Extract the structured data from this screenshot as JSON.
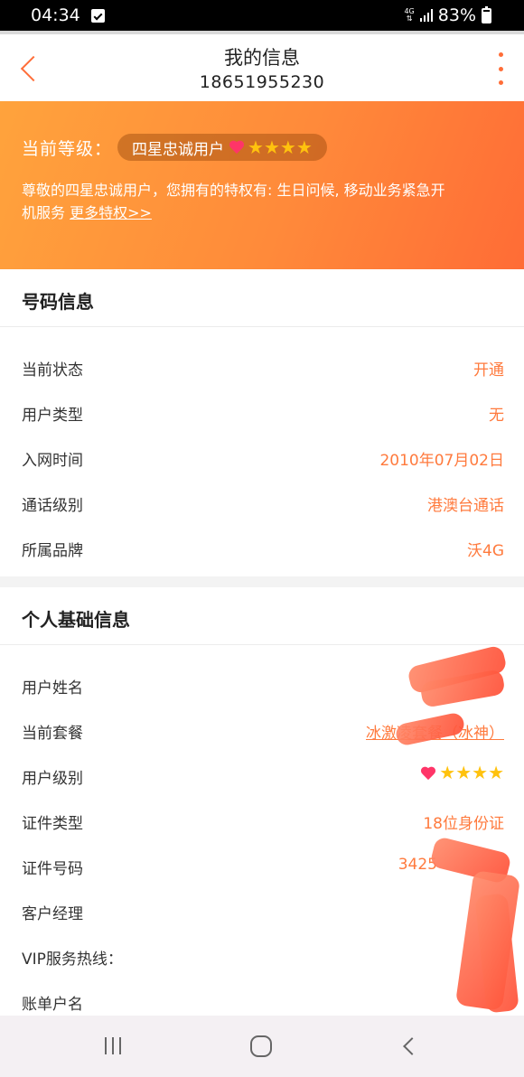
{
  "status_bar": {
    "time": "04:34",
    "network": "4G",
    "battery": "83%",
    "battery_level": 0.83
  },
  "header": {
    "title": "我的信息",
    "phone": "18651955230"
  },
  "banner": {
    "level_label": "当前等级：",
    "level_name": "四星忠诚用户",
    "stars": 4,
    "privilege_text": "尊敬的四星忠诚用户，您拥有的特权有: 生日问候, 移动业务紧急开机服务 ",
    "more_link": "更多特权>>"
  },
  "number_info": {
    "title": "号码信息",
    "rows": [
      {
        "label": "当前状态",
        "value": "开通"
      },
      {
        "label": "用户类型",
        "value": "无"
      },
      {
        "label": "入网时间",
        "value": "2010年07月02日"
      },
      {
        "label": "通话级别",
        "value": "港澳台通话"
      },
      {
        "label": "所属品牌",
        "value": "沃4G"
      }
    ]
  },
  "personal_info": {
    "title": "个人基础信息",
    "rows": [
      {
        "label": "用户姓名",
        "value": ""
      },
      {
        "label": "当前套餐",
        "value": "冰激凌套餐（冰神）"
      },
      {
        "label": "用户级别",
        "value": ""
      },
      {
        "label": "证件类型",
        "value": "18位身份证"
      },
      {
        "label": "证件号码",
        "value": "3425"
      },
      {
        "label": "客户经理",
        "value": ""
      },
      {
        "label": "VIP服务热线：",
        "value": ""
      },
      {
        "label": "账单户名",
        "value": ""
      }
    ]
  },
  "colors": {
    "accent": "#ff7a3d",
    "banner_start": "#ffa33c",
    "banner_end": "#ff6c36",
    "star": "#ffc20e",
    "heart": "#ff3568"
  },
  "icons": {
    "back": "chevron-left-icon",
    "more": "more-vertical-icon",
    "heart": "heart-icon",
    "star": "star-icon"
  }
}
